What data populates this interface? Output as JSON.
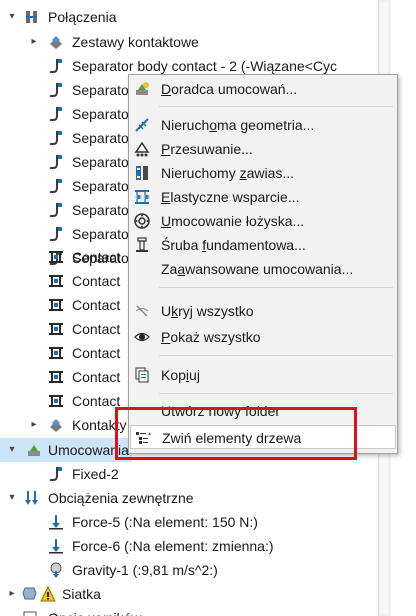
{
  "tree": {
    "rows": [
      {
        "label": "Połączenia",
        "icon": "connections-icon"
      },
      {
        "label": "Zestawy kontaktowe",
        "icon": "contact-set-icon"
      },
      {
        "label": "Separator body contact - 2 (-Wiązane<Cyc",
        "icon": "body-contact-icon"
      },
      {
        "label": "Separato",
        "icon": "body-contact-icon"
      },
      {
        "label": "Separato",
        "icon": "body-contact-icon"
      },
      {
        "label": "Separato",
        "icon": "body-contact-icon"
      },
      {
        "label": "Separato",
        "icon": "body-contact-icon"
      },
      {
        "label": "Separato",
        "icon": "body-contact-icon"
      },
      {
        "label": "Separato",
        "icon": "body-contact-icon"
      },
      {
        "label": "Separato",
        "icon": "body-contact-icon"
      },
      {
        "label": "Separato",
        "icon": "body-contact-icon"
      },
      {
        "label": "Contact",
        "icon": "contact-icon"
      },
      {
        "label": "Contact",
        "icon": "contact-icon"
      },
      {
        "label": "Contact",
        "icon": "contact-icon"
      },
      {
        "label": "Contact",
        "icon": "contact-icon"
      },
      {
        "label": "Contact",
        "icon": "contact-icon"
      },
      {
        "label": "Contact",
        "icon": "contact-icon"
      },
      {
        "label": "Contact",
        "icon": "contact-icon"
      },
      {
        "label": "Kontakty",
        "icon": "contacts-folder-icon"
      },
      {
        "label": "Umocowania",
        "icon": "fixtures-icon"
      },
      {
        "label": "Fixed-2",
        "icon": "fixed-icon"
      },
      {
        "label": "Obciążenia zewnętrzne",
        "icon": "external-loads-icon"
      },
      {
        "label": "Force-5 (:Na element: 150 N:)",
        "icon": "force-icon"
      },
      {
        "label": "Force-6 (:Na element: zmienna:)",
        "icon": "force-icon"
      },
      {
        "label": "Gravity-1 (:9,81 m/s^2:)",
        "icon": "gravity-icon"
      },
      {
        "label": "Siatka",
        "icon": "mesh-icon"
      },
      {
        "label": "Opcje wyników",
        "icon": "result-options-icon"
      }
    ]
  },
  "menu": {
    "items": [
      {
        "pre": "",
        "u": "D",
        "post": "oradca umocowań...",
        "icon": "fixture-advisor-icon"
      },
      {
        "pre": "Nieruch",
        "u": "o",
        "post": "ma geometria...",
        "icon": "fixed-geometry-icon"
      },
      {
        "pre": "",
        "u": "P",
        "post": "rzesuwanie...",
        "icon": "roller-slider-icon"
      },
      {
        "pre": "Nieruchomy ",
        "u": "z",
        "post": "awias...",
        "icon": "fixed-hinge-icon"
      },
      {
        "pre": "",
        "u": "E",
        "post": "lastyczne wsparcie...",
        "icon": "elastic-support-icon"
      },
      {
        "pre": "",
        "u": "U",
        "post": "mocowanie łożyska...",
        "icon": "bearing-fixture-icon"
      },
      {
        "pre": "Śruba ",
        "u": "f",
        "post": "undamentowa...",
        "icon": "foundation-bolt-icon"
      },
      {
        "pre": "Za",
        "u": "a",
        "post": "wansowane umocowania...",
        "icon": ""
      },
      {
        "pre": "U",
        "u": "k",
        "post": "ryj wszystko",
        "icon": "hide-all-icon"
      },
      {
        "pre": "",
        "u": "P",
        "post": "okaż wszystko",
        "icon": "show-all-icon"
      },
      {
        "pre": "Kop",
        "u": "i",
        "post": "uj",
        "icon": "copy-icon"
      },
      {
        "pre": "Utwórz nowy folder",
        "u": "",
        "post": "",
        "icon": ""
      },
      {
        "pre": "Zwiń elementy drzewa",
        "u": "",
        "post": "",
        "icon": "collapse-tree-icon"
      }
    ]
  },
  "colors": {
    "accent_blue": "#1f6fb5",
    "highlight_red": "#e30d1d",
    "selection": "#cce4f7"
  }
}
